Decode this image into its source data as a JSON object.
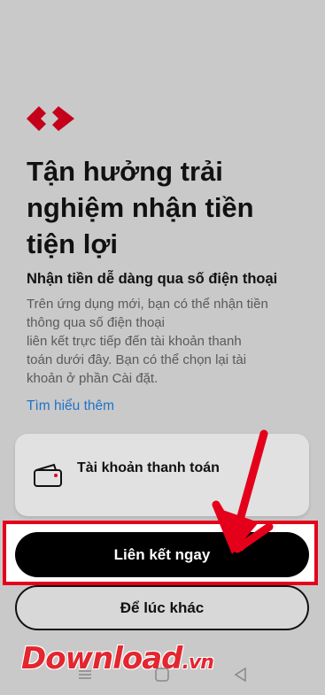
{
  "title": "Tận hưởng trải nghiệm nhận tiền tiện lợi",
  "subtitle": "Nhận tiền dễ dàng qua số điện thoại",
  "body": "Trên ứng dụng mới, bạn có thể nhận tiền\nthông qua số điện thoại\nliên kết trực tiếp đến tài khoản thanh\ntoán dưới đây. Bạn có thể chọn lại tài\nkhoản ở phần Cài đặt.",
  "learn_more": "Tìm hiểu thêm",
  "account_card": {
    "label": "Tài khoản thanh toán",
    "icon": "wallet-icon"
  },
  "buttons": {
    "primary": "Liên kết ngay",
    "secondary": "Để lúc khác"
  },
  "watermark": {
    "text": "Download",
    "suffix": ".vn"
  },
  "nav": {
    "items": [
      "menu-icon",
      "home-icon",
      "back-icon"
    ]
  },
  "colors": {
    "brand_red": "#e4001b",
    "link_blue": "#1f73c8",
    "background": "#c9c9c9"
  }
}
